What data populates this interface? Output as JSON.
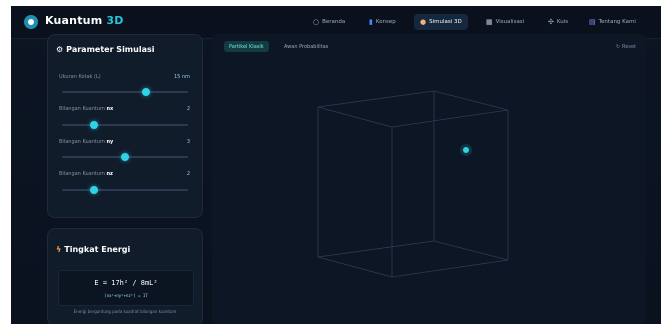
{
  "brand": {
    "name": "Kuantum",
    "suffix": "3D"
  },
  "nav": [
    {
      "label": "Beranda",
      "icon": "circle-icon"
    },
    {
      "label": "Konsep",
      "icon": "book-icon"
    },
    {
      "label": "Simulasi 3D",
      "icon": "atom-icon"
    },
    {
      "label": "Visualisasi",
      "icon": "chart-icon"
    },
    {
      "label": "Kuis",
      "icon": "puzzle-icon"
    },
    {
      "label": "Tentang Kami",
      "icon": "users-icon"
    }
  ],
  "params": {
    "title": "Parameter Simulasi",
    "box": {
      "label": "Ukuran Kotak (L)",
      "value": "15 nm",
      "level": 0.67
    },
    "nx": {
      "label_prefix": "Bilangan Kuantum",
      "label_symbol": "nx",
      "value": "2",
      "level": 0.25
    },
    "ny": {
      "label_prefix": "Bilangan Kuantum",
      "label_symbol": "ny",
      "value": "3",
      "level": 0.5
    },
    "nz": {
      "label_prefix": "Bilangan Kuantum",
      "label_symbol": "nz",
      "value": "2",
      "level": 0.25
    }
  },
  "energy": {
    "title": "Tingkat Energi",
    "formula": "E = 17h² / 8mL²",
    "sub": "(nx²+ny²+nz²) = 17",
    "note": "Energi bergantung pada kuadrat bilangan kuantum"
  },
  "viewer": {
    "tab_active": "Partikel Klasik",
    "tab_inactive": "Awan Probabilitas",
    "reset_label": "Reset"
  },
  "colors": {
    "accent": "#26c6da",
    "background": "#0c1523",
    "panel": "#111c2b",
    "particle": "#2ed3e6",
    "energy_icon": "#ff9f43"
  }
}
